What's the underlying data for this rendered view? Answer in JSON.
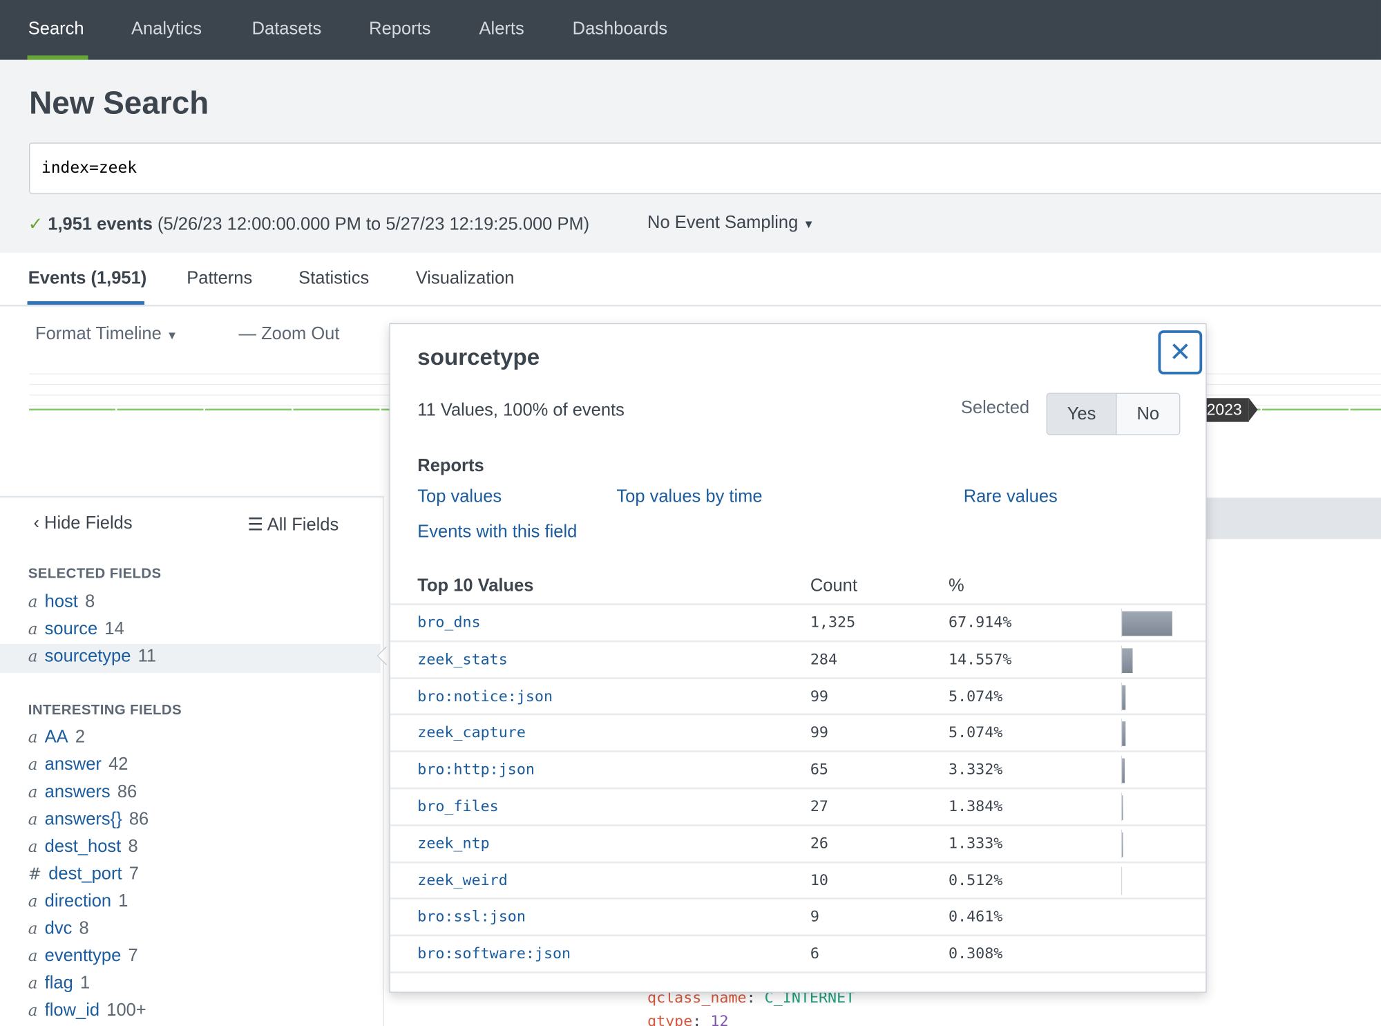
{
  "nav": {
    "items": [
      "Search",
      "Analytics",
      "Datasets",
      "Reports",
      "Alerts",
      "Dashboards"
    ],
    "active": "Search"
  },
  "header": {
    "title": "New Search",
    "query": "index=zeek"
  },
  "status": {
    "count": "1,951 events",
    "range": "(5/26/23 12:00:00.000 PM to 5/27/23 12:19:25.000 PM)",
    "sampling": "No Event Sampling"
  },
  "tabs": [
    "Events (1,951)",
    "Patterns",
    "Statistics",
    "Visualization"
  ],
  "timeline": {
    "format": "Format Timeline",
    "zoom_out": "Zoom Out",
    "label": "2023"
  },
  "fields": {
    "hide": "Hide Fields",
    "all": "All Fields",
    "selected_header": "SELECTED FIELDS",
    "selected": [
      {
        "type": "a",
        "name": "host",
        "count": "8"
      },
      {
        "type": "a",
        "name": "source",
        "count": "14"
      },
      {
        "type": "a",
        "name": "sourcetype",
        "count": "11"
      }
    ],
    "interesting_header": "INTERESTING FIELDS",
    "interesting": [
      {
        "type": "a",
        "name": "AA",
        "count": "2"
      },
      {
        "type": "a",
        "name": "answer",
        "count": "42"
      },
      {
        "type": "a",
        "name": "answers",
        "count": "86"
      },
      {
        "type": "a",
        "name": "answers{}",
        "count": "86"
      },
      {
        "type": "a",
        "name": "dest_host",
        "count": "8"
      },
      {
        "type": "#",
        "name": "dest_port",
        "count": "7"
      },
      {
        "type": "a",
        "name": "direction",
        "count": "1"
      },
      {
        "type": "a",
        "name": "dvc",
        "count": "8"
      },
      {
        "type": "a",
        "name": "eventtype",
        "count": "7"
      },
      {
        "type": "a",
        "name": "flag",
        "count": "1"
      },
      {
        "type": "a",
        "name": "flow_id",
        "count": "100+"
      }
    ]
  },
  "events": {
    "line1_key": "qclass_name",
    "line1_val": "C_INTERNET",
    "line2_key": "qtype",
    "line2_val": "12"
  },
  "popup": {
    "title": "sourcetype",
    "summary": "11 Values, 100% of events",
    "selected_label": "Selected",
    "yes": "Yes",
    "no": "No",
    "selected_value": "Yes",
    "reports_label": "Reports",
    "links": [
      "Top values",
      "Top values by time",
      "Rare values",
      "Events with this field"
    ],
    "table_headers": [
      "Top 10 Values",
      "Count",
      "%"
    ],
    "rows": [
      {
        "value": "bro_dns",
        "count": "1,325",
        "pct": "67.914%",
        "p": 67.914
      },
      {
        "value": "zeek_stats",
        "count": "284",
        "pct": "14.557%",
        "p": 14.557
      },
      {
        "value": "bro:notice:json",
        "count": "99",
        "pct": "5.074%",
        "p": 5.074
      },
      {
        "value": "zeek_capture",
        "count": "99",
        "pct": "5.074%",
        "p": 5.074
      },
      {
        "value": "bro:http:json",
        "count": "65",
        "pct": "3.332%",
        "p": 3.332
      },
      {
        "value": "bro_files",
        "count": "27",
        "pct": "1.384%",
        "p": 1.384
      },
      {
        "value": "zeek_ntp",
        "count": "26",
        "pct": "1.333%",
        "p": 1.333
      },
      {
        "value": "zeek_weird",
        "count": "10",
        "pct": "0.512%",
        "p": 0.512
      },
      {
        "value": "bro:ssl:json",
        "count": "9",
        "pct": "0.461%",
        "p": 0.461
      },
      {
        "value": "bro:software:json",
        "count": "6",
        "pct": "0.308%",
        "p": 0.308
      }
    ]
  },
  "colors": {
    "nav_bg": "#3c444d",
    "active_green": "#65a637",
    "link_blue": "#1a5c9e",
    "tab_blue": "#2f73b6"
  }
}
